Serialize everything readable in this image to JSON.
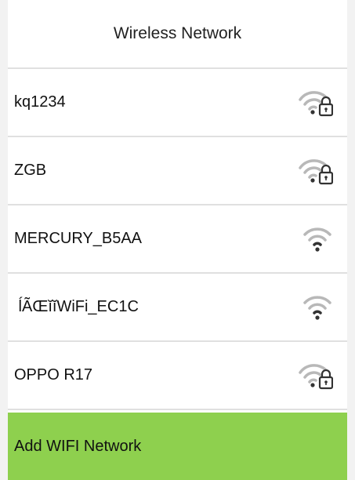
{
  "header": {
    "title": "Wireless Network"
  },
  "networks": [
    {
      "ssid": "kq1234",
      "icon": "wifi-locked-icon"
    },
    {
      "ssid": "ZGB",
      "icon": "wifi-locked-icon"
    },
    {
      "ssid": "MERCURY_B5AA",
      "icon": "wifi-open-icon"
    },
    {
      "ssid": " ĺÃŒĭĭWiFi_EC1C",
      "icon": "wifi-open-icon"
    },
    {
      "ssid": "OPPO R17",
      "icon": "wifi-locked-icon"
    }
  ],
  "footer": {
    "add_label": "Add WIFI Network"
  },
  "colors": {
    "accent": "#8ed04e",
    "divider": "#e0e0e0",
    "icon_gray": "#b8b8b8",
    "icon_dark": "#333333"
  }
}
